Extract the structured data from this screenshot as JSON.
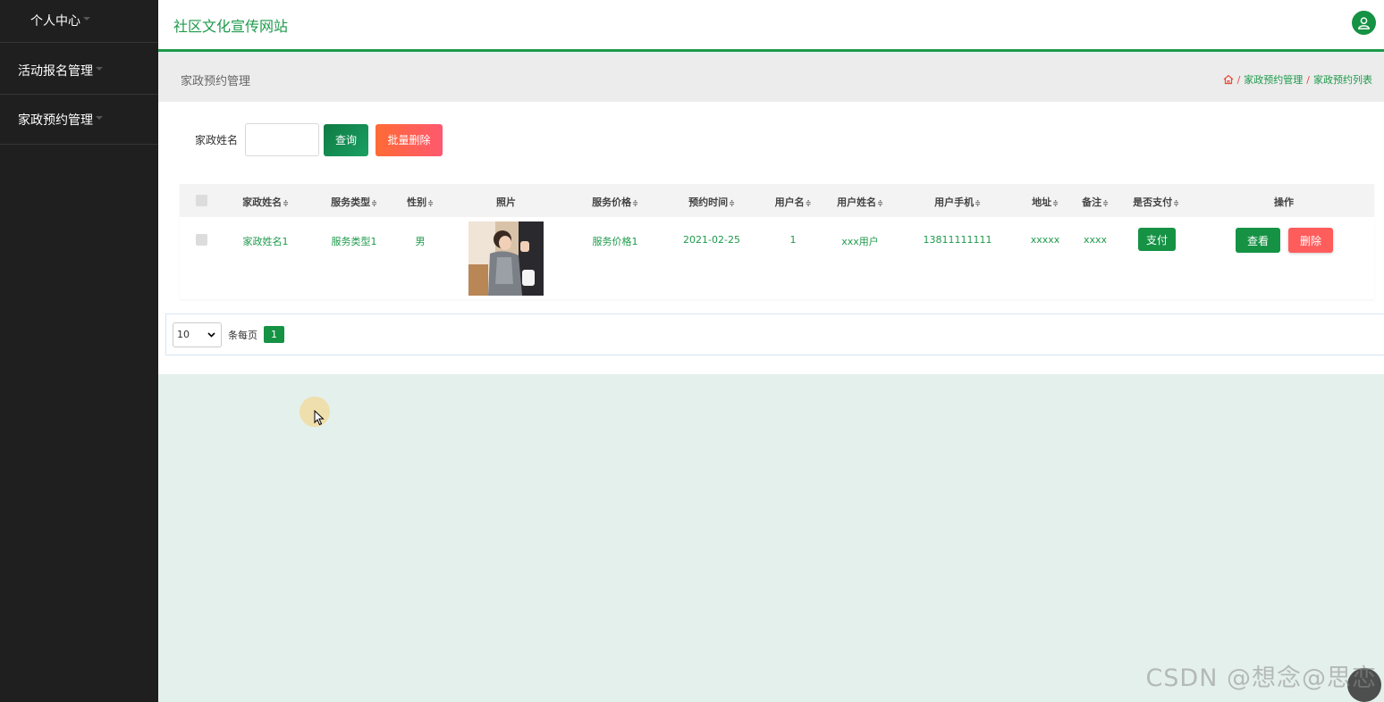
{
  "sidebar": {
    "items": [
      {
        "label": "个人中心"
      },
      {
        "label": "活动报名管理"
      },
      {
        "label": "家政预约管理"
      }
    ]
  },
  "header": {
    "site_title": "社区文化宣传网站",
    "user_icon": "user-icon"
  },
  "page": {
    "title": "家政预约管理",
    "breadcrumb": [
      "家政预约管理",
      "家政预约列表"
    ],
    "breadcrumb_sep": "/"
  },
  "search": {
    "label": "家政姓名",
    "value": "",
    "query_label": "查询",
    "batch_delete_label": "批量删除"
  },
  "table": {
    "columns": [
      "家政姓名",
      "服务类型",
      "性别",
      "照片",
      "服务价格",
      "预约时间",
      "用户名",
      "用户姓名",
      "用户手机",
      "地址",
      "备注",
      "是否支付",
      "操作"
    ],
    "sort_glyph": "≑",
    "rows": [
      {
        "name": "家政姓名1",
        "service_type": "服务类型1",
        "gender": "男",
        "price": "服务价格1",
        "time": "2021-02-25",
        "username": "1",
        "user_realname": "xxx用户",
        "phone": "13811111111",
        "address": "xxxxx",
        "remark": "xxxx",
        "pay_label": "支付",
        "view_label": "查看",
        "delete_label": "删除"
      }
    ]
  },
  "pagination": {
    "page_size": "10",
    "per_page_label": "条每页",
    "current_page": "1"
  },
  "watermark": "CSDN @想念@思恋",
  "colors": {
    "accent": "#1e9a4b",
    "sidebar_bg": "#1f1f1f",
    "danger": "#ff5c5c"
  }
}
